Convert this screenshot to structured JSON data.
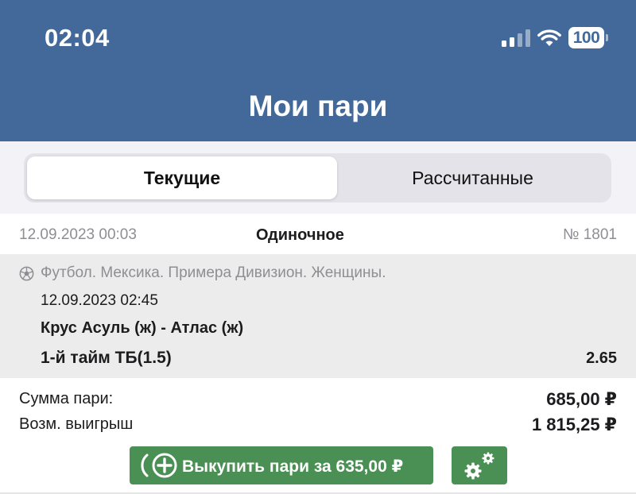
{
  "status_bar": {
    "time": "02:04",
    "battery": "100"
  },
  "header": {
    "title": "Мои пари"
  },
  "tabs": [
    {
      "label": "Текущие",
      "active": true
    },
    {
      "label": "Рассчитанные",
      "active": false
    }
  ],
  "bet": {
    "datetime": "12.09.2023 00:03",
    "type": "Одиночное",
    "number": "№ 1801",
    "event": {
      "league": "Футбол. Мексика. Примера Дивизион. Женщины.",
      "datetime": "12.09.2023 02:45",
      "teams": "Крус Асуль (ж) - Атлас (ж)",
      "market": "1-й тайм ТБ(1.5)",
      "odds": "2.65",
      "sport_icon": "soccer-ball-icon"
    },
    "stake_label": "Сумма пари:",
    "stake_value": "685,00 ₽",
    "payout_label": "Возм. выигрыш",
    "payout_value": "1 815,25 ₽"
  },
  "actions": {
    "cashout_label": "Выкупить пари за 635,00 ₽",
    "cashout_icon": "cashout-plus-icon",
    "settings_icon": "gears-icon"
  },
  "colors": {
    "header_bg": "#43699a",
    "button_green": "#4a8f53"
  }
}
